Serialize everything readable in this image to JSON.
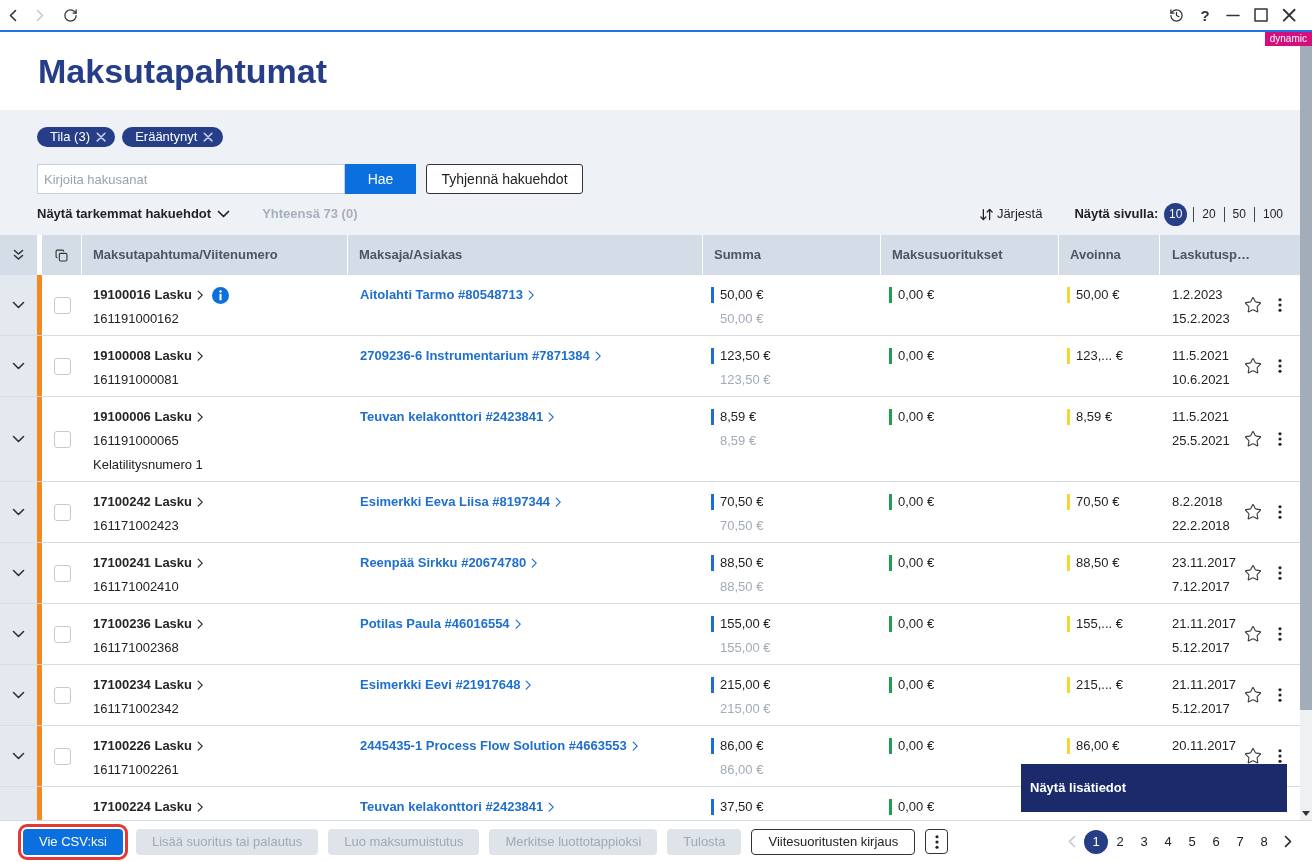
{
  "browser_bar": {
    "back": {
      "disabled": false
    },
    "forward": {
      "disabled": true
    },
    "help": "?"
  },
  "badge": "dynamic",
  "title": "Maksutapahtumat",
  "filters": {
    "chips": [
      {
        "label": "Tila (3)"
      },
      {
        "label": "Erääntynyt"
      }
    ],
    "search": {
      "placeholder": "Kirjoita hakusanat",
      "button": "Hae"
    },
    "clear_button": "Tyhjennä hakuehdot",
    "advanced_toggle": {
      "label": "Näytä tarkemmat hakuehdot",
      "expanded": false
    },
    "total": "Yhteensä 73 (0)",
    "sort_button": "Järjestä",
    "page_size": {
      "label": "Näytä sivulla:",
      "options": [
        {
          "label": "10",
          "selected": true
        },
        {
          "label": "20",
          "selected": false
        },
        {
          "label": "50",
          "selected": false
        },
        {
          "label": "100",
          "selected": false
        }
      ]
    }
  },
  "table": {
    "columns": [
      "Maksutapahtuma/Viitenumero",
      "Maksaja/Asiakas",
      "Summa",
      "Maksusuoritukset",
      "Avoinna",
      "Laskutusp…"
    ],
    "rows": [
      {
        "expanded": false,
        "color": "#f5891f",
        "checked": false,
        "number": "19100016 Lasku",
        "info": true,
        "reference": "161191000162",
        "payer": "Aitolahti Tarmo #80548713",
        "amount": "50,00 €",
        "original_amount": "50,00 €",
        "paid": "0,00 €",
        "open": "50,00 €",
        "dates": [
          "1.2.2023",
          "15.2.2023"
        ],
        "favorite": false
      },
      {
        "expanded": false,
        "color": "#f5891f",
        "checked": false,
        "number": "19100008 Lasku",
        "info": false,
        "reference": "161191000081",
        "payer": "2709236-6 Instrumentarium #7871384",
        "amount": "123,50 €",
        "original_amount": "123,50 €",
        "paid": "0,00 €",
        "open": "123,... €",
        "dates": [
          "11.5.2021",
          "10.6.2021"
        ],
        "favorite": false
      },
      {
        "expanded": false,
        "color": "#f5891f",
        "checked": false,
        "number": "19100006 Lasku",
        "info": false,
        "reference": "161191000065",
        "note": "Kelatilitysnumero 1",
        "payer": "Teuvan kelakonttori #2423841",
        "amount": "8,59 €",
        "original_amount": "8,59 €",
        "paid": "0,00 €",
        "open": "8,59 €",
        "dates": [
          "11.5.2021",
          "25.5.2021"
        ],
        "favorite": false
      },
      {
        "expanded": false,
        "color": "#f5891f",
        "checked": false,
        "number": "17100242 Lasku",
        "info": false,
        "reference": "161171002423",
        "payer": "Esimerkki Eeva Liisa #8197344",
        "amount": "70,50 €",
        "original_amount": "70,50 €",
        "paid": "0,00 €",
        "open": "70,50 €",
        "dates": [
          "8.2.2018",
          "22.2.2018"
        ],
        "favorite": false
      },
      {
        "expanded": false,
        "color": "#f5891f",
        "checked": false,
        "number": "17100241 Lasku",
        "info": false,
        "reference": "161171002410",
        "payer": "Reenpää Sirkku #20674780",
        "amount": "88,50 €",
        "original_amount": "88,50 €",
        "paid": "0,00 €",
        "open": "88,50 €",
        "dates": [
          "23.11.2017",
          "7.12.2017"
        ],
        "favorite": false
      },
      {
        "expanded": false,
        "color": "#f5891f",
        "checked": false,
        "number": "17100236 Lasku",
        "info": false,
        "reference": "161171002368",
        "payer": "Potilas Paula #46016554",
        "amount": "155,00 €",
        "original_amount": "155,00 €",
        "paid": "0,00 €",
        "open": "155,... €",
        "dates": [
          "21.11.2017",
          "5.12.2017"
        ],
        "favorite": false
      },
      {
        "expanded": false,
        "color": "#f5891f",
        "checked": false,
        "number": "17100234 Lasku",
        "info": false,
        "reference": "161171002342",
        "payer": "Esimerkki Eevi #21917648",
        "amount": "215,00 €",
        "original_amount": "215,00 €",
        "paid": "0,00 €",
        "open": "215,... €",
        "dates": [
          "21.11.2017",
          "5.12.2017"
        ],
        "favorite": false
      },
      {
        "expanded": false,
        "color": "#f5891f",
        "checked": false,
        "number": "17100226 Lasku",
        "info": false,
        "reference": "161171002261",
        "payer": "2445435-1 Process Flow Solution #4663553",
        "amount": "86,00 €",
        "original_amount": "86,00 €",
        "paid": "0,00 €",
        "open": "86,00 €",
        "dates": [
          "20.11.2017"
        ],
        "favorite": false
      },
      {
        "color": "#f5891f",
        "number": "17100224 Lasku",
        "info": false,
        "payer": "Teuvan kelakonttori #2423841",
        "amount": "37,50 €",
        "paid": "0,00 €"
      }
    ]
  },
  "tooltip": "Näytä lisätiedot",
  "toolbar": {
    "buttons": [
      {
        "label": "Vie CSV:ksi",
        "kind": "primary",
        "disabled": false,
        "highlighted": true
      },
      {
        "label": "Lisää suoritus tai palautus",
        "kind": "primary",
        "disabled": true,
        "highlighted": false
      },
      {
        "label": "Luo maksumuistutus",
        "kind": "primary",
        "disabled": true,
        "highlighted": false
      },
      {
        "label": "Merkitse luottotappioksi",
        "kind": "primary",
        "disabled": true,
        "highlighted": false
      },
      {
        "label": "Tulosta",
        "kind": "primary",
        "disabled": true,
        "highlighted": false
      },
      {
        "label": "Viitesuoritusten kirjaus",
        "kind": "outline",
        "disabled": false,
        "highlighted": false
      }
    ]
  },
  "pagination": {
    "previous": {
      "disabled": true
    },
    "pages": [
      {
        "label": "1",
        "selected": true
      },
      {
        "label": "2",
        "selected": false
      },
      {
        "label": "3",
        "selected": false
      },
      {
        "label": "4",
        "selected": false
      },
      {
        "label": "5",
        "selected": false
      },
      {
        "label": "6",
        "selected": false
      },
      {
        "label": "7",
        "selected": false
      },
      {
        "label": "8",
        "selected": false
      }
    ],
    "next": {
      "disabled": false
    }
  }
}
